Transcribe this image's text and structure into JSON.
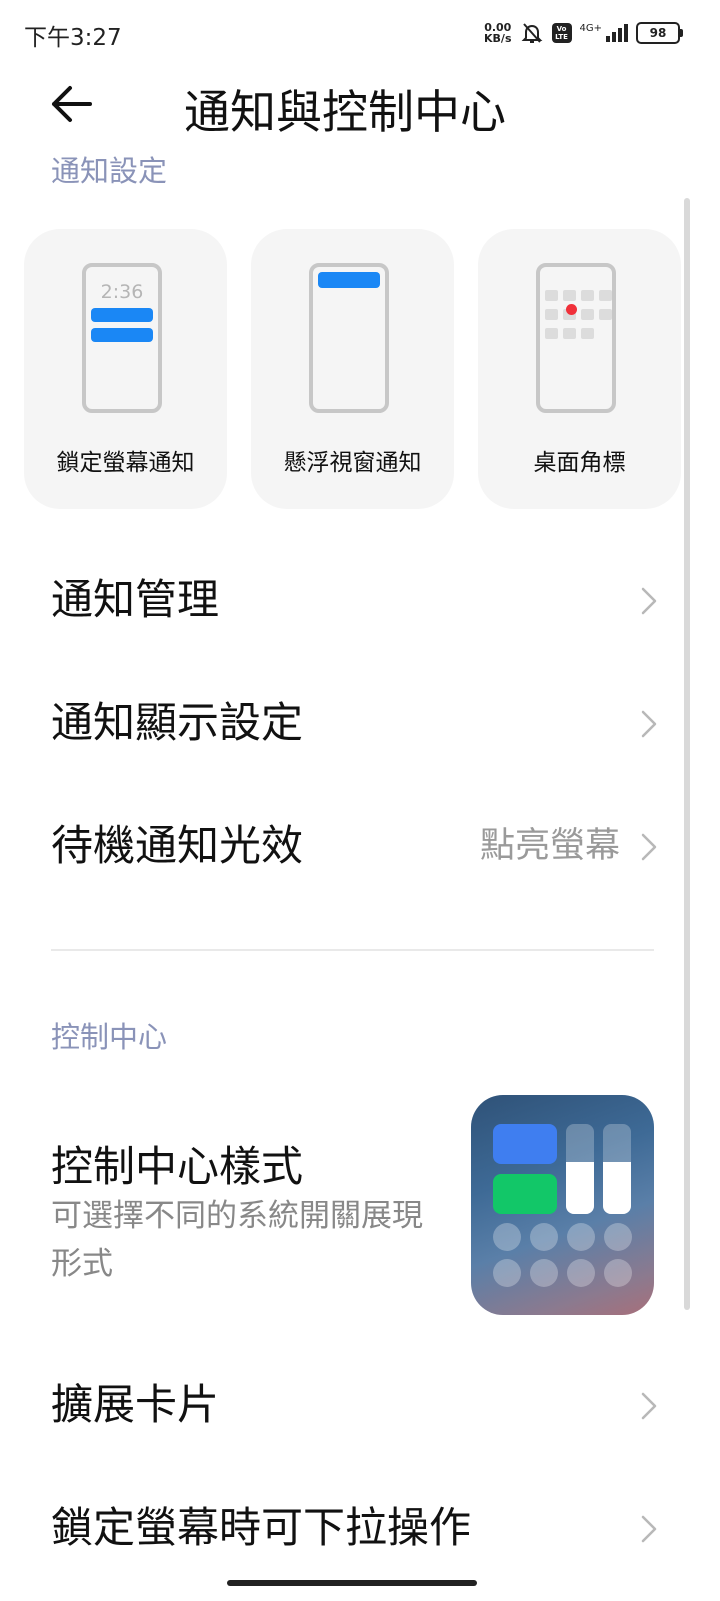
{
  "status_bar": {
    "time": "下午3:27",
    "net_speed_value": "0.00",
    "net_speed_unit": "KB/s",
    "volte_top": "Vo",
    "volte_bottom": "LTE",
    "network_type": "4G+",
    "battery": "98"
  },
  "header": {
    "title": "通知與控制中心",
    "back_icon": "back-arrow-icon"
  },
  "notification_section": {
    "label": "通知設定",
    "cards": [
      {
        "label": "鎖定螢幕通知",
        "preview_time": "2:36"
      },
      {
        "label": "懸浮視窗通知"
      },
      {
        "label": "桌面角標"
      }
    ],
    "rows": [
      {
        "title": "通知管理",
        "value": ""
      },
      {
        "title": "通知顯示設定",
        "value": ""
      },
      {
        "title": "待機通知光效",
        "value": "點亮螢幕"
      }
    ]
  },
  "control_center_section": {
    "label": "控制中心",
    "style": {
      "title": "控制中心樣式",
      "subtitle": "可選擇不同的系統開關展現形式"
    },
    "rows": [
      {
        "title": "擴展卡片"
      },
      {
        "title": "鎖定螢幕時可下拉操作"
      }
    ]
  },
  "colors": {
    "accent_blue": "#1a87f5",
    "badge_red": "#f0303a",
    "section_label": "#8a93b8",
    "tile_blue": "#3f7ef0",
    "tile_green": "#12c768"
  }
}
